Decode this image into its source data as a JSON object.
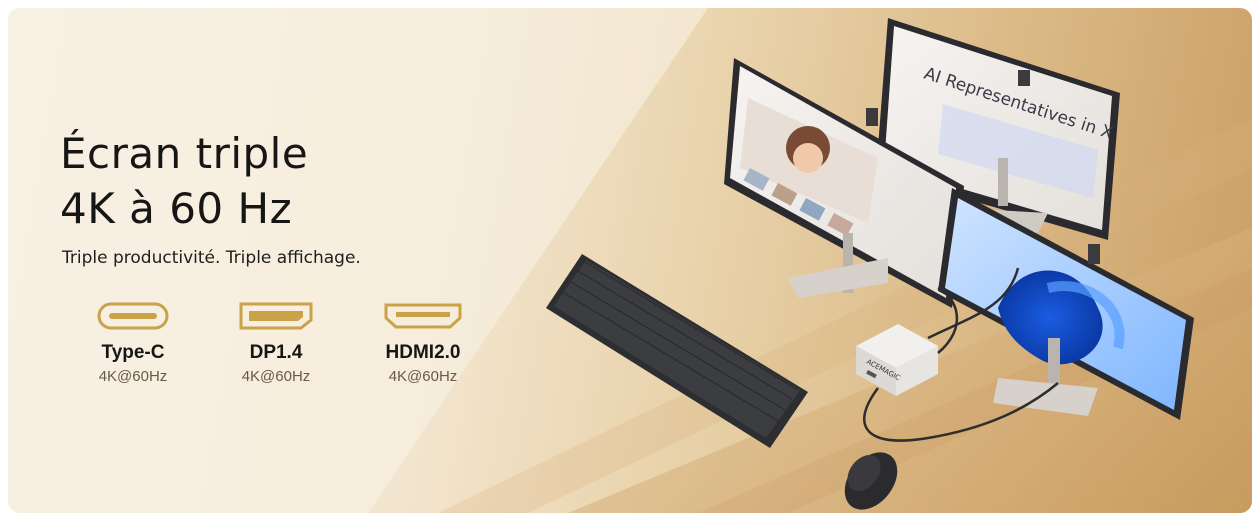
{
  "headline": {
    "line1": "Écran triple",
    "line2": "4K à 60 Hz"
  },
  "tagline": "Triple productivité. Triple affichage.",
  "ports": [
    {
      "icon": "usb-c-port-icon",
      "name": "Type-C",
      "spec": "4K@60Hz"
    },
    {
      "icon": "displayport-icon",
      "name": "DP1.4",
      "spec": "4K@60Hz"
    },
    {
      "icon": "hdmi-port-icon",
      "name": "HDMI2.0",
      "spec": "4K@60Hz"
    }
  ],
  "screens": {
    "back_monitor_heading": "AI Representatives in X",
    "mini_pc_logo": "ACEMAGIC"
  },
  "colors": {
    "gold_accent": "#c9a24a",
    "headline_text": "#161616",
    "spec_text": "#6a5a44"
  }
}
